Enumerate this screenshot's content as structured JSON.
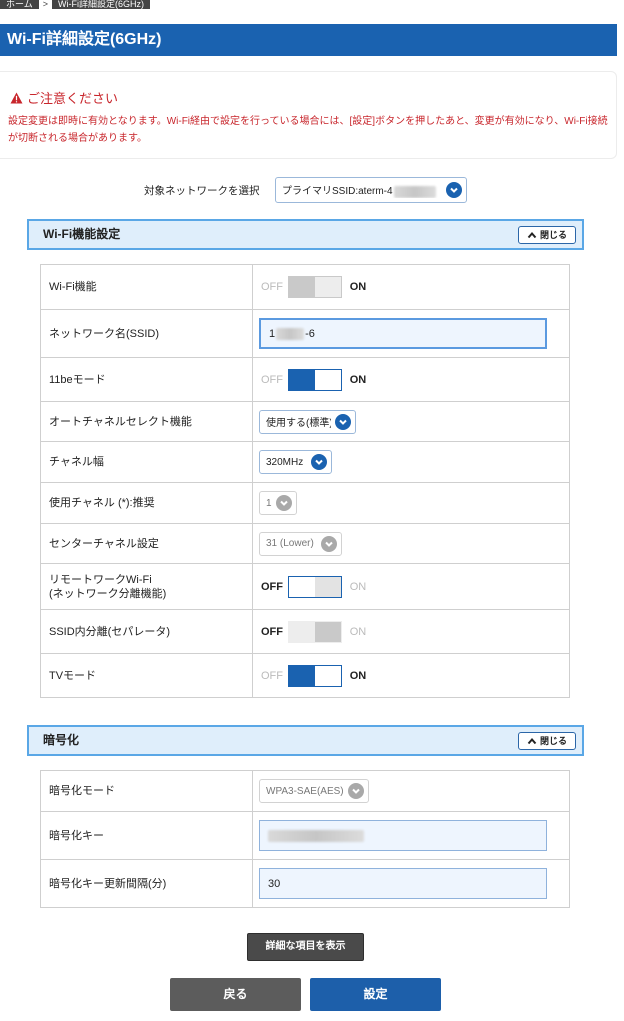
{
  "breadcrumb": {
    "home": "ホーム",
    "separator": ">",
    "current": "Wi-Fi詳細設定(6GHz)"
  },
  "page_title": "Wi-Fi詳細設定(6GHz)",
  "notice": {
    "title": "ご注意ください",
    "text": "設定変更は即時に有効となります。Wi-Fi経由で設定を行っている場合には、[設定]ボタンを押したあと、変更が有効になり、Wi-Fi接続が切断される場合があります。"
  },
  "network_select": {
    "label": "対象ネットワークを選択",
    "value": "プライマリSSID:aterm-4"
  },
  "wifi_section": {
    "title": "Wi-Fi機能設定",
    "collapse_label": "閉じる",
    "rows": {
      "wifi": {
        "label": "Wi-Fi機能",
        "off": "OFF",
        "on": "ON",
        "state": "on",
        "enabled": false
      },
      "ssid": {
        "label": "ネットワーク名(SSID)",
        "value": "1",
        "value_suffix": "-6"
      },
      "mode11be": {
        "label": "11beモード",
        "off": "OFF",
        "on": "ON",
        "state": "on"
      },
      "auto_channel": {
        "label": "オートチャネルセレクト機能",
        "value": "使用する(標準)"
      },
      "channel_width": {
        "label": "チャネル幅",
        "value": "320MHz"
      },
      "channel": {
        "label": "使用チャネル (*):推奨",
        "value": "1"
      },
      "center_channel": {
        "label": "センターチャネル設定",
        "value": "31 (Lower)"
      },
      "remote_work": {
        "label_line1": "リモートワークWi-Fi",
        "label_line2": "(ネットワーク分離機能)",
        "off": "OFF",
        "on": "ON",
        "state": "off"
      },
      "ssid_separator": {
        "label": "SSID内分離(セパレータ)",
        "off": "OFF",
        "on": "ON",
        "state": "off",
        "enabled": false
      },
      "tv_mode": {
        "label": "TVモード",
        "off": "OFF",
        "on": "ON",
        "state": "on"
      }
    }
  },
  "encryption_section": {
    "title": "暗号化",
    "collapse_label": "閉じる",
    "rows": {
      "mode": {
        "label": "暗号化モード",
        "value": "WPA3-SAE(AES)"
      },
      "key": {
        "label": "暗号化キー",
        "value": ""
      },
      "interval": {
        "label": "暗号化キー更新間隔(分)",
        "value": "30"
      }
    }
  },
  "buttons": {
    "show_detail": "詳細な項目を表示",
    "back": "戻る",
    "set": "設定"
  },
  "colors": {
    "brand_blue": "#1a62b0",
    "warning_red": "#c8262c",
    "section_bg": "#dfeefb"
  }
}
